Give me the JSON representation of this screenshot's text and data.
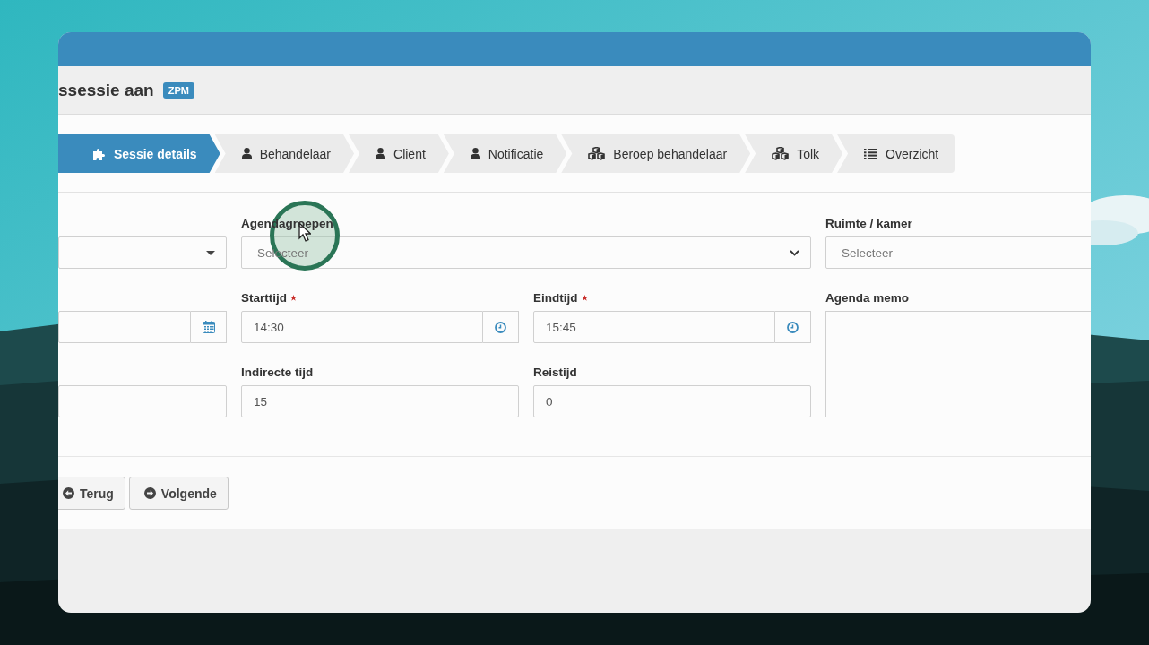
{
  "window": {
    "title": "ssessie aan",
    "badge": "ZPM"
  },
  "steps": [
    {
      "label": "Sessie details",
      "kind": "puzzle",
      "selected": true
    },
    {
      "label": "Behandelaar",
      "kind": "user",
      "selected": false
    },
    {
      "label": "Cliënt",
      "kind": "user",
      "selected": false
    },
    {
      "label": "Notificatie",
      "kind": "user",
      "selected": false
    },
    {
      "label": "Beroep behandelaar",
      "kind": "cubes",
      "selected": false
    },
    {
      "label": "Tolk",
      "kind": "cubes",
      "selected": false
    },
    {
      "label": "Overzicht",
      "kind": "list",
      "selected": false
    }
  ],
  "fields": [
    {
      "kind": "select"
    },
    {
      "kind": "multiselect",
      "label": "Agendagroepen",
      "required": false,
      "placeholder": "Selecteer"
    },
    {
      "kind": "search-select",
      "label": "Ruimte / kamer",
      "required": false,
      "placeholder": "Selecteer"
    },
    {
      "kind": "date"
    },
    {
      "kind": "time",
      "label": "Starttijd",
      "required": true,
      "value": "14:30"
    },
    {
      "kind": "time",
      "label": "Eindtijd",
      "required": true,
      "value": "15:45"
    },
    {
      "kind": "textarea",
      "label": "Agenda memo",
      "required": false
    },
    {
      "kind": "text"
    },
    {
      "kind": "text",
      "label": "Indirecte tijd",
      "required": false,
      "value": "15"
    },
    {
      "kind": "text",
      "label": "Reistijd",
      "required": false,
      "value": "0"
    }
  ],
  "buttons": [
    {
      "label": "Terug",
      "kind": "back"
    },
    {
      "label": "Volgende",
      "kind": "next"
    }
  ]
}
